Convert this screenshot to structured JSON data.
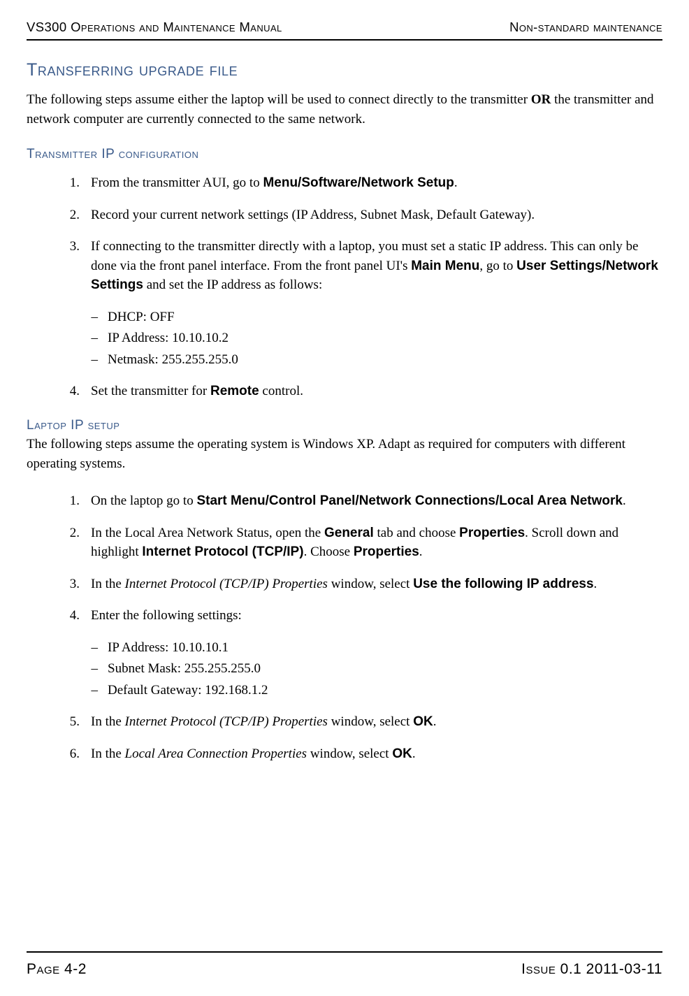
{
  "header": {
    "left": "VS300 Operations and Maintenance Manual",
    "right": "Non-standard maintenance"
  },
  "title1": "Transferring upgrade file",
  "intro1_a": "The following steps assume either the laptop will be used to connect directly to the transmitter ",
  "intro1_b": "OR",
  "intro1_c": " the transmitter and network computer are currently connected to the same network.",
  "sub1": "Transmitter IP configuration",
  "s1": {
    "i1_a": "From the transmitter AUI, go to ",
    "i1_b": "Menu/Software/Network Setup",
    "i1_c": ".",
    "i2": "Record your current network settings (IP Address, Subnet Mask, Default Gateway).",
    "i3_a": "If connecting to the transmitter directly with a laptop, you must set a static IP address. This can only be done via the front panel interface. From the front panel UI's ",
    "i3_b": "Main Menu",
    "i3_c": ", go to ",
    "i3_d": "User Settings/Network Settings",
    "i3_e": " and set the IP address as follows:",
    "b1": "DHCP: OFF",
    "b2": "IP Address: 10.10.10.2",
    "b3": "Netmask: 255.255.255.0",
    "i4_a": "Set the transmitter for ",
    "i4_b": "Remote",
    "i4_c": " control."
  },
  "sub2": "Laptop IP setup",
  "intro2": "The following steps assume the operating system is Windows XP. Adapt as required for computers with different operating systems.",
  "s2": {
    "i1_a": "On the laptop go to ",
    "i1_b": "Start Menu/Control Panel/Network Connections/Local Area Network",
    "i1_c": ".",
    "i2_a": "In the Local Area Network Status, open the ",
    "i2_b": "General",
    "i2_c": " tab and choose ",
    "i2_d": "Properties",
    "i2_e": ". Scroll down and highlight ",
    "i2_f": "Internet Protocol (TCP/IP)",
    "i2_g": ". Choose ",
    "i2_h": "Properties",
    "i2_i": ".",
    "i3_a": "In the ",
    "i3_b": "Internet Protocol (TCP/IP) Properties",
    "i3_c": " window, select ",
    "i3_d": "Use the following IP address",
    "i3_e": ".",
    "i4": "Enter the following settings:",
    "b1": "IP Address: 10.10.10.1",
    "b2": "Subnet Mask: 255.255.255.0",
    "b3": "Default Gateway: 192.168.1.2",
    "i5_a": "In the ",
    "i5_b": "Internet Protocol (TCP/IP) Properties",
    "i5_c": " window, select ",
    "i5_d": "OK",
    "i5_e": ".",
    "i6_a": "In the ",
    "i6_b": "Local Area Connection Properties",
    "i6_c": " window, select ",
    "i6_d": "OK",
    "i6_e": "."
  },
  "footer": {
    "left": "Page 4-2",
    "right": "Issue 0.1  2011-03-11"
  }
}
